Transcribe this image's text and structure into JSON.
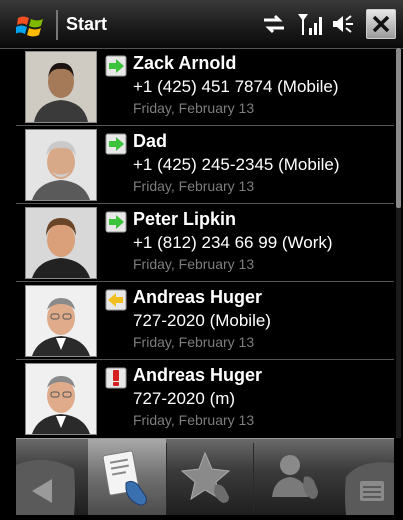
{
  "status_bar": {
    "title": "Start",
    "icons": [
      "windows-logo-icon",
      "connectivity-icon",
      "signal-icon",
      "volume-icon",
      "close-icon"
    ]
  },
  "calls": [
    {
      "name": "Zack Arnold",
      "number": "+1 (425) 451 7874  (Mobile)",
      "date": "Friday, February 13",
      "direction": "outgoing",
      "direction_color": "#3cc33c"
    },
    {
      "name": "Dad",
      "number": "+1 (425) 245-2345 (Mobile)",
      "date": "Friday, February 13",
      "direction": "outgoing",
      "direction_color": "#3cc33c"
    },
    {
      "name": "Peter Lipkin",
      "number": "+1 (812) 234 66 99  (Work)",
      "date": "Friday, February 13",
      "direction": "outgoing",
      "direction_color": "#3cc33c"
    },
    {
      "name": "Andreas Huger",
      "number": "727-2020 (Mobile)",
      "date": "Friday, February 13",
      "direction": "incoming",
      "direction_color": "#f2c01e"
    },
    {
      "name": "Andreas Huger",
      "number": "727-2020 (m)",
      "date": "Friday, February 13",
      "direction": "missed",
      "direction_color": "#d62020"
    }
  ],
  "tabs": [
    {
      "icon": "back-arrow-icon"
    },
    {
      "icon": "call-history-icon",
      "active": true
    },
    {
      "icon": "speed-dial-star-icon"
    },
    {
      "icon": "contacts-phone-icon"
    },
    {
      "icon": "menu-icon"
    }
  ]
}
